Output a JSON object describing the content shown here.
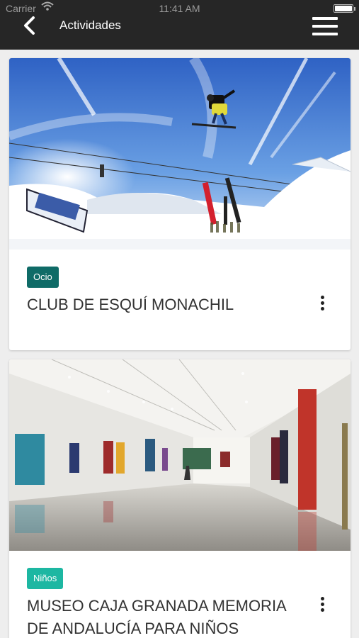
{
  "status_bar": {
    "carrier": "Carrier",
    "time": "11:41 AM"
  },
  "header": {
    "title": "Actividades",
    "back_icon": "chevron-left-icon",
    "menu_icon": "hamburger-menu-icon"
  },
  "colors": {
    "appbar": "#262626",
    "badge_ocio": "#0f6b67",
    "badge_ninos": "#1db7a2"
  },
  "cards": [
    {
      "category": "Ocio",
      "title": "CLUB DE ESQUÍ MONACHIL",
      "image": "ski-jump-photo",
      "more_icon": "more-vertical-icon"
    },
    {
      "category": "Niños",
      "title": "MUSEO CAJA GRANADA MEMORIA DE ANDALUCÍA PARA NIÑOS",
      "image": "museum-gallery-photo",
      "more_icon": "more-vertical-icon"
    }
  ]
}
